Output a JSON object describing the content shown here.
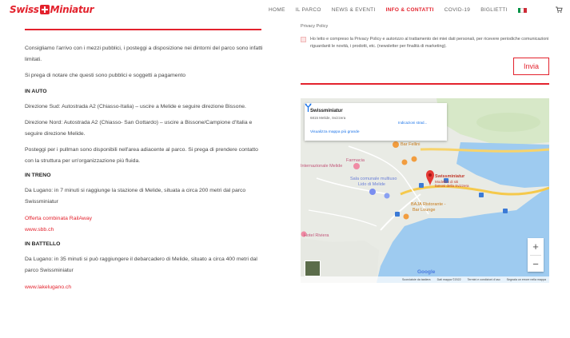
{
  "header": {
    "logo_part1": "Swiss",
    "logo_part2": "Miniatur",
    "nav": [
      {
        "label": "HOME",
        "active": false
      },
      {
        "label": "IL PARCO",
        "active": false
      },
      {
        "label": "NEWS & EVENTI",
        "active": false
      },
      {
        "label": "INFO & CONTATTI",
        "active": true
      },
      {
        "label": "COVID-19",
        "active": false
      },
      {
        "label": "BIGLIETTI",
        "active": false
      }
    ],
    "flag_colors": [
      "#009246",
      "#ffffff",
      "#ce2b37"
    ],
    "accent": "#e3222d"
  },
  "left": {
    "intro1": "Consigliamo l'arrivo con i mezzi pubblici, i posteggi a disposizione nei dintorni del parco sono infatti limitati.",
    "intro2": "Si prega di notare che questi sono pubblici e soggetti a pagamento",
    "auto_heading": "IN AUTO",
    "auto_south": "Direzione Sud: Autostrada A2 (Chiasso-Italia) – uscire a Melide e seguire direzione Bissone.",
    "auto_north": "Direzione Nord: Autostrada A2 (Chiasso- San Gottardo) – uscire a Bissone/Campione d'Italia e seguire direzione Melide.",
    "bus": "Posteggi per i pullman sono disponibili nell'area adiacente al parco. Si prega di prendere contatto con la struttura per un'organizzazione più fluida.",
    "train_heading": "IN TRENO",
    "train_text": "Da Lugano: in 7 minuti si raggiunge la stazione di Melide, situata a circa 200 metri dal parco Swissminiatur",
    "train_link1": "Offerta combinata RailAway",
    "train_link2": "www.sbb.ch",
    "boat_heading": "IN BATTELLO",
    "boat_text": "Da Lugano: in 35 minuti si può raggiungere il debarcadero di Melide, situato a circa 400 metri dal parco Swissminiatur",
    "boat_link": "www.lakelugano.ch"
  },
  "form": {
    "privacy_title": "Privacy Policy",
    "privacy_text": "Ho letto e compreso la Privacy Policy e autorizzo al trattamento dei miei dati personali, per ricevere periodiche comunicazioni riguardanti le novità, i prodotti, etc. (newsletter per finalità di marketing).",
    "send_label": "Invia"
  },
  "map": {
    "card_title": "Swissminiatur",
    "card_address": "6815 Melide, Svizzera",
    "card_link": "Visualizza mappa più grande",
    "directions_label": "Indicazioni strad...",
    "labels": {
      "bar_fellini": "Bar Fellini",
      "farmacia1": "Farmacia",
      "farmacia2": "Internazionale Melide",
      "sala1": "Sala comunale multiuso",
      "sala2": "Lido di Melide",
      "swiss1": "Swissminiatur",
      "swiss2": "Modellini di siti",
      "swiss3": "famosi della Svizzera",
      "baja1": "BAJA Ristorante -",
      "baja2": "Bar Lounge",
      "hotel": "Hotel Riviera"
    },
    "zoom_in": "+",
    "zoom_out": "−",
    "google_logo": "Google",
    "attribution": [
      "Scorciatoie da tastiera",
      "Dati mappa ©2022",
      "Termini e condizioni d'uso",
      "Segnala un errore nella mappa"
    ]
  }
}
